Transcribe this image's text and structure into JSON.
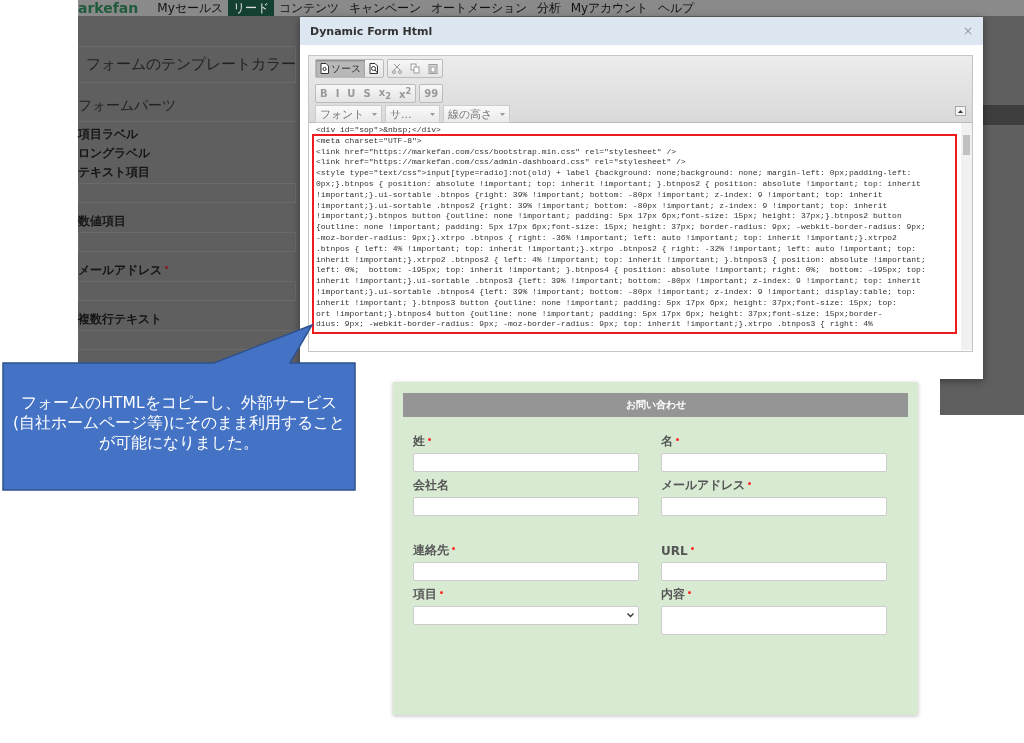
{
  "background_page": {
    "logo": "arkefan",
    "nav": [
      {
        "label": "Myセールス",
        "selected": false
      },
      {
        "label": "リード",
        "selected": true
      },
      {
        "label": "コンテンツ",
        "selected": false
      },
      {
        "label": "キャンペーン",
        "selected": false
      },
      {
        "label": "オートメーション",
        "selected": false
      },
      {
        "label": "分析",
        "selected": false
      },
      {
        "label": "Myアカウント",
        "selected": false
      },
      {
        "label": "ヘルプ",
        "selected": false
      }
    ],
    "heading": "フォームのテンプレートカラー",
    "section_title": "フォームパーツ",
    "parts": [
      {
        "label": "項目ラベル",
        "kind": "label",
        "required": false
      },
      {
        "label": "ロングラベル",
        "kind": "label",
        "required": false
      },
      {
        "label": "テキスト項目",
        "kind": "input",
        "required": false
      },
      {
        "label": "数値項目",
        "kind": "input",
        "required": false
      },
      {
        "label": "メールアドレス",
        "kind": "input",
        "required": true
      },
      {
        "label": "複数行テキスト",
        "kind": "input",
        "required": false
      }
    ]
  },
  "dialog": {
    "title": "Dynamic Form Html",
    "close": "×",
    "toolbar": [
      [
        {
          "kind": "source",
          "label": "ソース",
          "selected": true,
          "disabled": false
        },
        {
          "kind": "preview",
          "selected": false,
          "disabled": false
        }
      ],
      [
        {
          "kind": "cut",
          "selected": false,
          "disabled": true
        },
        {
          "kind": "copy",
          "selected": false,
          "disabled": true
        },
        {
          "kind": "paste",
          "selected": false,
          "disabled": true
        }
      ],
      [
        {
          "kind": "text",
          "label": "B",
          "selected": false,
          "disabled": true
        },
        {
          "kind": "text",
          "label": "I",
          "selected": false,
          "disabled": true
        },
        {
          "kind": "text",
          "label": "U",
          "selected": false,
          "disabled": true
        },
        {
          "kind": "text",
          "label": "S",
          "selected": false,
          "disabled": true
        },
        {
          "kind": "text",
          "label": "x$_{2}$",
          "selected": false,
          "disabled": true
        },
        {
          "kind": "text",
          "label": "x$^{2}$",
          "selected": false,
          "disabled": true
        }
      ],
      [
        {
          "kind": "text",
          "label": "99",
          "selected": false,
          "disabled": true
        }
      ]
    ],
    "dropdowns": [
      {
        "label": "フォント"
      },
      {
        "label": "サ..."
      },
      {
        "label": "線の高さ"
      }
    ],
    "code_lines": [
      "<div id=\"sop\">&nbsp;</div>",
      "<meta charset=\"UTF-8\">",
      "<link href=\"https://markefan.com/css/bootstrap.min.css\" rel=\"stylesheet\" />",
      "<link href=\"https://markefan.com/css/admin-dashboard.css\" rel=\"stylesheet\" />",
      "<style type=\"text/css\">input[type=radio]:not(old) + label {background: none;background: none; margin-left: 0px;padding-left:",
      "0px;}.btnpos { position: absolute !important; top: inherit !important; }.btnpos2 { position: absolute !important; top: inherit",
      "!important;}.ui-sortable .btnpos {right: 39% !important; bottom: -80px !important; z-index: 9 !important; top: inherit",
      "!important;}.ui-sortable .btnpos2 {right: 39% !important; bottom: -80px !important; z-index: 9 !important; top: inherit",
      "!important;}.btnpos button {outline: none !important; padding: 5px 17px 6px;font-size: 15px; height: 37px;}.btnpos2 button",
      "{outline: none !important; padding: 5px 17px 6px;font-size: 15px; height: 37px; border-radius: 9px; -webkit-border-radius: 9px;",
      "-moz-border-radius: 9px;}.xtrpo .btnpos { right: -36% !important; left: auto !important; top: inherit !important;}.xtrpo2",
      ".btnpos { left: 4% !important; top: inherit !important;}.xtrpo .btnpos2 { right: -32% !important; left: auto !important; top:",
      "inherit !important;}.xtrpo2 .btnpos2 { left: 4% !important; top: inherit !important; }.btnpos3 { position: absolute !important;",
      "left: 0%;  bottom: -195px; top: inherit !important; }.btnpos4 { position: absolute !important; right: 0%;  bottom: -195px; top:",
      "inherit !important;}.ui-sortable .btnpos3 {left: 39% !important; bottom: -80px !important; z-index: 9 !important; top: inherit",
      "!important;}.ui-sortable .btnpos4 {left: 39% !important; bottom: -80px !important; z-index: 9 !important; display:table; top:",
      "inherit !important; }.btnpos3 button {outline: none !important; padding: 5px 17px 6px; height: 37px;font-size: 15px; top:",
      "ort !important;}.btnpos4 button {outline: none !important; padding: 5px 17px 6px; height: 37px;font-size: 15px;border-",
      "dius: 9px; -webkit-border-radius: 9px; -moz-border-radius: 9px; top: inherit !important;}.xtrpo .btnpos3 { right: 4%"
    ]
  },
  "form_preview": {
    "title": "お問い合わせ",
    "field_groups": [
      [
        [
          {
            "label": "姓",
            "required": true,
            "kind": "text"
          },
          {
            "label": "名",
            "required": true,
            "kind": "text"
          }
        ],
        [
          {
            "label": "会社名",
            "required": false,
            "kind": "text"
          },
          {
            "label": "メールアドレス",
            "required": true,
            "kind": "text"
          }
        ]
      ],
      [
        [
          {
            "label": "連絡先",
            "required": true,
            "kind": "text"
          },
          {
            "label": "URL",
            "required": true,
            "kind": "text"
          }
        ],
        [
          {
            "label": "項目",
            "required": true,
            "kind": "select"
          },
          {
            "label": "内容",
            "required": true,
            "kind": "textarea"
          }
        ]
      ]
    ]
  },
  "callout": {
    "text": "フォームのHTMLをコピーし、外部サービス(自社ホームページ等)にそのまま利用することが可能になりました。"
  }
}
